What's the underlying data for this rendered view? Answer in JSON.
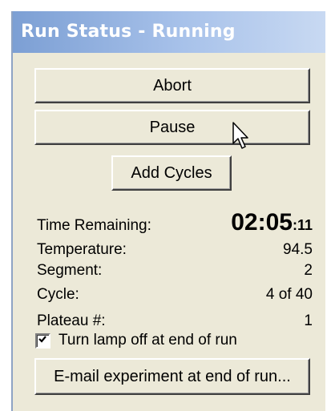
{
  "window": {
    "title": "Run Status - Running"
  },
  "buttons": {
    "abort": "Abort",
    "pause": "Pause",
    "add_cycles": "Add Cycles",
    "email": "E-mail experiment at end of run..."
  },
  "status": {
    "time_remaining_label": "Time Remaining:",
    "time_remaining_main": "02:05",
    "time_remaining_seconds": ":11",
    "temperature_label": "Temperature:",
    "temperature_value": "94.5",
    "segment_label": "Segment:",
    "segment_value": "2",
    "cycle_label": "Cycle:",
    "cycle_value": "4 of 40",
    "plateau_label": "Plateau #:",
    "plateau_value": "1"
  },
  "options": {
    "lamp_off_label": "Turn lamp off at end of run",
    "lamp_off_checked": true
  },
  "icons": {
    "checkmark": "checkmark-icon",
    "cursor": "mouse-pointer-icon"
  },
  "colors": {
    "titlebar_start": "#7c9fd4",
    "titlebar_end": "#c8d9f2",
    "panel_bg": "#ece9d8"
  }
}
